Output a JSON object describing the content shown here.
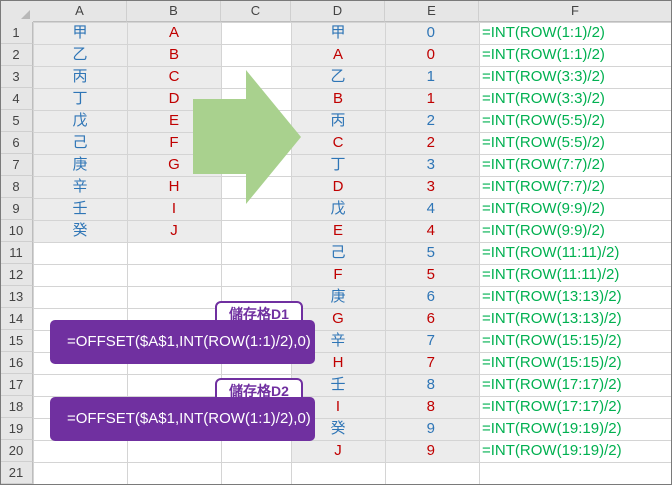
{
  "sheet": {
    "columns": [
      "A",
      "B",
      "C",
      "D",
      "E",
      "F"
    ],
    "rows": [
      "1",
      "2",
      "3",
      "4",
      "5",
      "6",
      "7",
      "8",
      "9",
      "10",
      "11",
      "12",
      "13",
      "14",
      "15",
      "16",
      "17",
      "18",
      "19",
      "20",
      "21"
    ]
  },
  "cells": {
    "A": [
      "甲",
      "乙",
      "丙",
      "丁",
      "戊",
      "己",
      "庚",
      "辛",
      "壬",
      "癸"
    ],
    "B": [
      "A",
      "B",
      "C",
      "D",
      "E",
      "F",
      "G",
      "H",
      "I",
      "J"
    ],
    "D": [
      "甲",
      "A",
      "乙",
      "B",
      "丙",
      "C",
      "丁",
      "D",
      "戊",
      "E",
      "己",
      "F",
      "庚",
      "G",
      "辛",
      "H",
      "壬",
      "I",
      "癸",
      "J"
    ],
    "E": [
      "0",
      "0",
      "1",
      "1",
      "2",
      "2",
      "3",
      "3",
      "4",
      "4",
      "5",
      "5",
      "6",
      "6",
      "7",
      "7",
      "8",
      "8",
      "9",
      "9"
    ],
    "F": [
      "=INT(ROW(1:1)/2)",
      "=INT(ROW(1:1)/2)",
      "=INT(ROW(3:3)/2)",
      "=INT(ROW(3:3)/2)",
      "=INT(ROW(5:5)/2)",
      "=INT(ROW(5:5)/2)",
      "=INT(ROW(7:7)/2)",
      "=INT(ROW(7:7)/2)",
      "=INT(ROW(9:9)/2)",
      "=INT(ROW(9:9)/2)",
      "=INT(ROW(11:11)/2)",
      "=INT(ROW(11:11)/2)",
      "=INT(ROW(13:13)/2)",
      "=INT(ROW(13:13)/2)",
      "=INT(ROW(15:15)/2)",
      "=INT(ROW(15:15)/2)",
      "=INT(ROW(17:17)/2)",
      "=INT(ROW(17:17)/2)",
      "=INT(ROW(19:19)/2)",
      "=INT(ROW(19:19)/2)"
    ]
  },
  "callouts": [
    {
      "tag": "儲存格D1",
      "formula": "=OFFSET($A$1,INT(ROW(1:1)/2),0)"
    },
    {
      "tag": "儲存格D2",
      "formula": "=OFFSET($A$1,INT(ROW(1:1)/2),0)"
    }
  ],
  "colors": {
    "blue_text": "#2e75b6",
    "red_text": "#c00000",
    "green_text": "#00b050",
    "purple": "#7030a0",
    "arrow_green": "#a9d18e",
    "shade": "#ececec",
    "gridline": "#d4d4d4",
    "header_bg": "#e6e6e6"
  },
  "icons": {
    "select_all": "select-all-triangle-icon",
    "arrow": "right-arrow-icon"
  }
}
